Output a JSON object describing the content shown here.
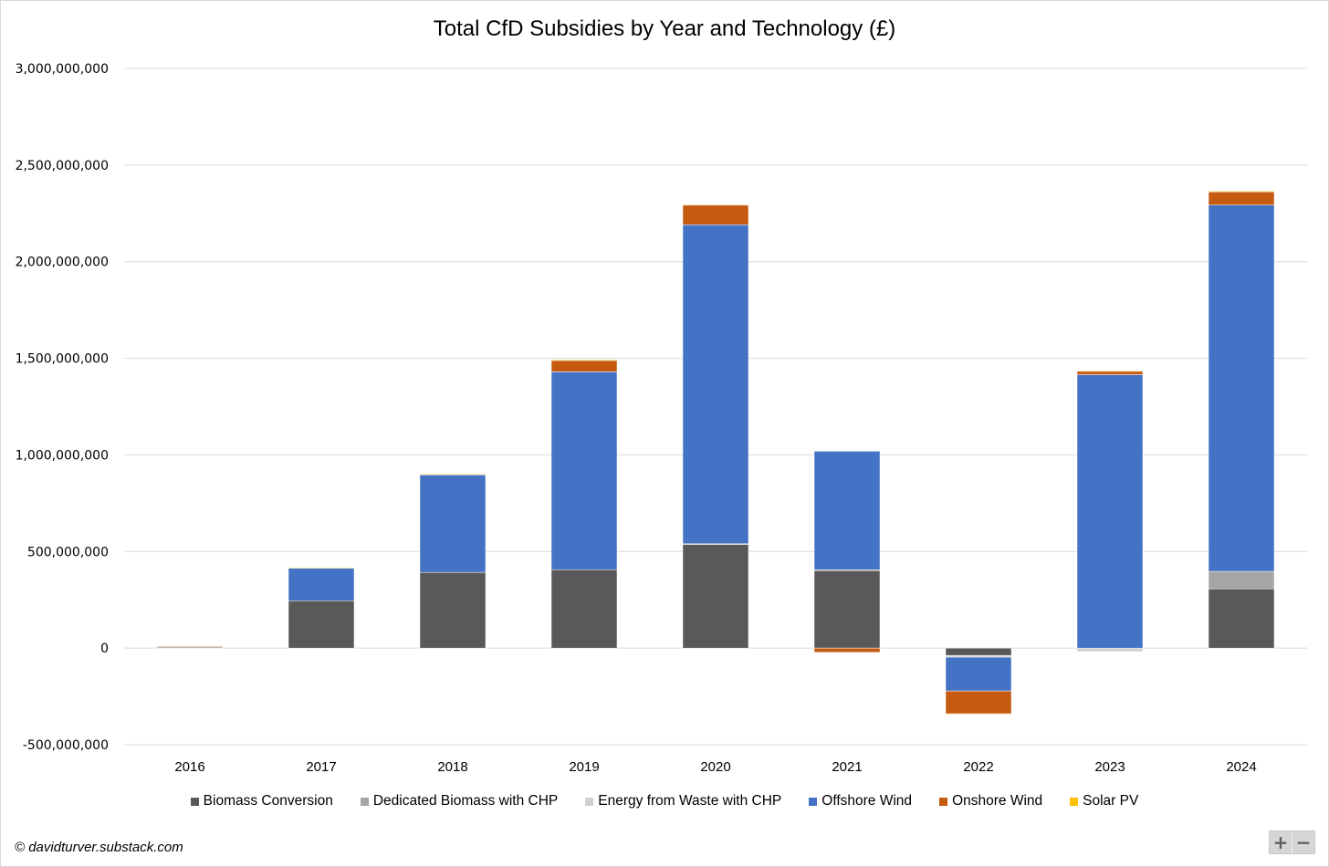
{
  "chart_data": {
    "type": "bar",
    "stacked": true,
    "title": "Total CfD Subsidies by Year and Technology (£)",
    "xlabel": "",
    "ylabel": "",
    "ylim": [
      -500000000,
      3000000000
    ],
    "yticks": [
      -500000000,
      0,
      500000000,
      1000000000,
      1500000000,
      2000000000,
      2500000000,
      3000000000
    ],
    "ytick_labels": [
      "-500,000,000",
      "0",
      "500,000,000",
      "1,000,000,000",
      "1,500,000,000",
      "2,000,000,000",
      "2,500,000,000",
      "3,000,000,000"
    ],
    "grid": true,
    "legend_position": "bottom",
    "categories": [
      "2016",
      "2017",
      "2018",
      "2019",
      "2020",
      "2021",
      "2022",
      "2023",
      "2024"
    ],
    "series": [
      {
        "name": "Biomass Conversion",
        "color": "#595959",
        "values": [
          6000000,
          245000000,
          392000000,
          406000000,
          538000000,
          401000000,
          -38000000,
          0,
          307000000
        ]
      },
      {
        "name": "Dedicated Biomass with CHP",
        "color": "#a5a5a5",
        "values": [
          0,
          0,
          0,
          0,
          0,
          5000000,
          0,
          0,
          90000000
        ]
      },
      {
        "name": "Energy from Waste with CHP",
        "color": "#d0d0d0",
        "values": [
          0,
          0,
          0,
          0,
          2000000,
          0,
          -9000000,
          -18000000,
          0
        ]
      },
      {
        "name": "Offshore Wind",
        "color": "#4472c4",
        "values": [
          0,
          170000000,
          505000000,
          1024000000,
          1651000000,
          613000000,
          -175000000,
          1415000000,
          1896000000
        ]
      },
      {
        "name": "Onshore Wind",
        "color": "#c55a11",
        "values": [
          2000000,
          2000000,
          3000000,
          61000000,
          104000000,
          -22000000,
          -118000000,
          20000000,
          71000000
        ]
      },
      {
        "name": "Solar PV",
        "color": "#ffc000",
        "values": [
          0,
          1000000,
          1000000,
          1000000,
          1000000,
          0,
          -1000000,
          1000000,
          1000000
        ]
      }
    ]
  },
  "footer": {
    "credit": "© davidturver.substack.com",
    "zoom_in": "+",
    "zoom_out": "−"
  }
}
